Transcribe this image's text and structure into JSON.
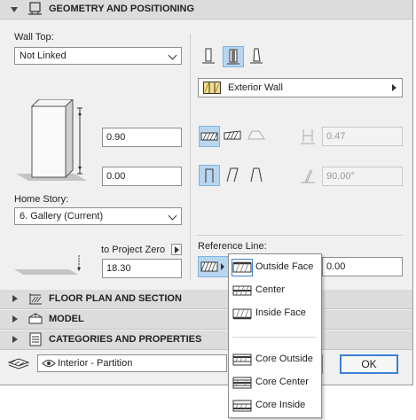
{
  "sections": {
    "geometry": "GEOMETRY AND POSITIONING",
    "floor_plan": "FLOOR PLAN AND SECTION",
    "model": "MODEL",
    "categories": "CATEGORIES AND PROPERTIES"
  },
  "wall_top": {
    "label": "Wall Top:",
    "value": "Not Linked"
  },
  "height_value": "0.90",
  "base_offset_value": "0.00",
  "home_story": {
    "label": "Home Story:",
    "value": "6. Gallery (Current)"
  },
  "to_project_zero": {
    "label": "to Project Zero",
    "value": "18.30"
  },
  "composite": {
    "name": "Exterior Wall"
  },
  "thickness_value": "0.47",
  "angle_value": "90.00°",
  "reference_line": {
    "label": "Reference Line:",
    "offset_value": "0.00",
    "options": [
      "Outside Face",
      "Center",
      "Inside Face",
      "Core Outside",
      "Core Center",
      "Core Inside"
    ],
    "selected": "Outside Face"
  },
  "layer": {
    "value": "Interior - Partition"
  },
  "buttons": {
    "ok": "OK"
  }
}
